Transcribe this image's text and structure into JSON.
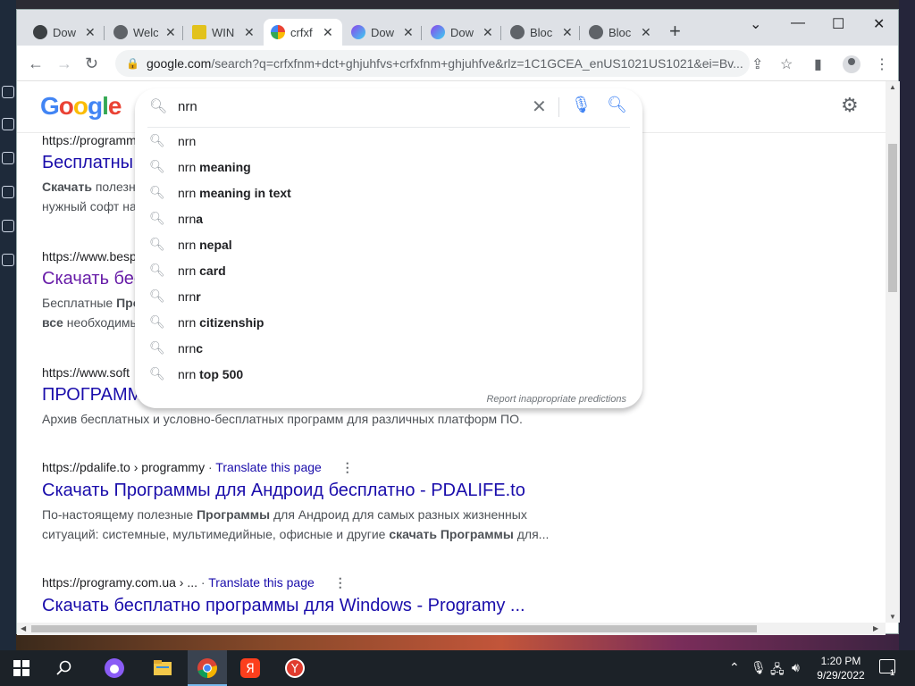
{
  "browser": {
    "tabs": [
      {
        "title": "Dow",
        "icon": "generic-page-icon"
      },
      {
        "title": "Welc",
        "icon": "globe-icon"
      },
      {
        "title": "WIN",
        "icon": "film-icon"
      },
      {
        "title": "crfxf",
        "icon": "google-icon",
        "active": true
      },
      {
        "title": "Dow",
        "icon": "video-app-icon"
      },
      {
        "title": "Dow",
        "icon": "video-app-icon"
      },
      {
        "title": "Bloc",
        "icon": "globe-icon"
      },
      {
        "title": "Bloc",
        "icon": "globe-icon"
      }
    ],
    "address": {
      "domain": "google.com",
      "path": "/search?q=crfxfnm+dct+ghjuhfvs+crfxfnm+ghjuhfve&rlz=1C1GCEA_enUS1021US1021&ei=Bv..."
    }
  },
  "google": {
    "logo": [
      "G",
      "o",
      "o",
      "g",
      "l",
      "e"
    ],
    "logo_colors": [
      "#4285f4",
      "#ea4335",
      "#fbbc05",
      "#4285f4",
      "#34a853",
      "#ea4335"
    ],
    "query": "nrn",
    "suggestions": [
      {
        "base": "nrn",
        "rest": ""
      },
      {
        "base": "nrn",
        "rest": " meaning"
      },
      {
        "base": "nrn",
        "rest": " meaning in text"
      },
      {
        "base": "nrn",
        "rest": "a"
      },
      {
        "base": "nrn",
        "rest": " nepal"
      },
      {
        "base": "nrn",
        "rest": " card"
      },
      {
        "base": "nrn",
        "rest": "r"
      },
      {
        "base": "nrn",
        "rest": " citizenship"
      },
      {
        "base": "nrn",
        "rest": "c"
      },
      {
        "base": "nrn",
        "rest": " top 500"
      }
    ],
    "report_text": "Report inappropriate predictions"
  },
  "results": [
    {
      "url": "https://programm",
      "title": "Бесплатны",
      "snippet_html": "<b>Скачать</b> полезн<br>нужный софт на",
      "visited": false
    },
    {
      "url": "https://www.besp",
      "title": "Скачать бес",
      "snippet_html": "Бесплатные <b>Про</b><br><b>все</b> необходимы",
      "visited": true
    },
    {
      "url": "https://www.soft",
      "title": "ПРОГРАММЫ - Скачать бесплатные программы",
      "snippet_html": "Архив бесплатных и условно-бесплатных программ для различных платформ ПО.",
      "visited": false
    },
    {
      "url": "https://pdalife.to › programmy",
      "translate": "Translate this page",
      "title": "Скачать Программы для Андроид бесплатно - PDALIFE.to",
      "snippet_html": "По-настоящему полезные <b>Программы</b> для Андроид для самых разных жизненных ситуаций: системные, мультимедийные, офисные и другие <b>скачать Программы</b> для...",
      "visited": false
    },
    {
      "url": "https://programy.com.ua › ...",
      "translate": "Translate this page",
      "title": "Скачать бесплатно программы для Windows - Programy ...",
      "snippet_html": "",
      "visited": false
    }
  ],
  "taskbar": {
    "time": "1:20 PM",
    "date": "9/29/2022",
    "notification_count": "1",
    "apps": [
      "windows-start-icon",
      "search-icon",
      "assistant-icon",
      "file-explorer-icon",
      "chrome-icon",
      "yandex-icon",
      "yandex-browser-icon"
    ]
  }
}
